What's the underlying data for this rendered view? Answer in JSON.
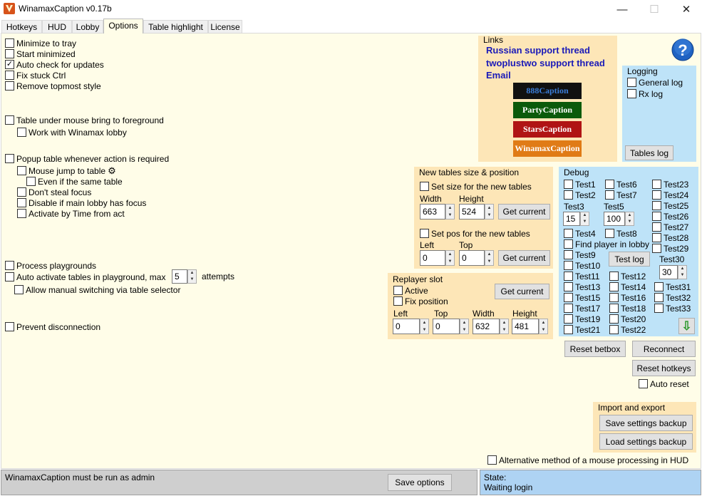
{
  "window": {
    "title": "WinamaxCaption v0.17b",
    "minimize": "—",
    "maximize": "☐",
    "close": "✕"
  },
  "tabs": [
    "Hotkeys",
    "HUD",
    "Lobby",
    "Options",
    "Table highlight",
    "License"
  ],
  "options": {
    "minimize_to_tray": "Minimize to tray",
    "start_minimized": "Start minimized",
    "auto_check_updates": "Auto check for updates",
    "fix_stuck_ctrl": "Fix stuck Ctrl",
    "remove_topmost": "Remove topmost style",
    "table_under_mouse": "Table under mouse bring to foreground",
    "work_with_lobby": "Work with Winamax lobby",
    "popup_table": "Popup table whenever action is required",
    "mouse_jump": "Mouse jump to table",
    "even_if_same": "Even if the same table",
    "dont_steal_focus": "Don't steal focus",
    "disable_if_lobby": "Disable if main lobby has focus",
    "activate_by_time": "Activate by Time from act",
    "process_playgrounds": "Process playgrounds",
    "auto_activate": "Auto activate tables in playground, max",
    "auto_activate_value": "5",
    "attempts": "attempts",
    "allow_manual": "Allow manual switching via table selector",
    "prevent_disconnection": "Prevent disconnection",
    "alt_mouse": "Alternative method of a mouse processing in HUD"
  },
  "links": {
    "title": "Links",
    "russian": "Russian support thread",
    "twoplustwo": "twoplustwo support thread",
    "email": "Email",
    "brands": [
      {
        "label": "888Caption",
        "bg": "#111111",
        "fg": "#3b7dd8"
      },
      {
        "label": "PartyCaption",
        "bg": "#0b5a0b",
        "fg": "#ffffff"
      },
      {
        "label": "StarsCaption",
        "bg": "#b01414",
        "fg": "#ffffff"
      },
      {
        "label": "WinamaxCaption",
        "bg": "#e07b16",
        "fg": "#ffffff"
      }
    ]
  },
  "logging": {
    "title": "Logging",
    "general": "General log",
    "rx": "Rx log",
    "tables_log": "Tables log"
  },
  "new_tables": {
    "title": "New tables size & position",
    "set_size": "Set size for the new tables",
    "width_label": "Width",
    "height_label": "Height",
    "width": "663",
    "height": "524",
    "get_current": "Get current",
    "set_pos": "Set pos for the new tables",
    "left_label": "Left",
    "top_label": "Top",
    "left": "0",
    "top": "0"
  },
  "replayer": {
    "title": "Replayer slot",
    "active": "Active",
    "fix_position": "Fix position",
    "get_current": "Get current",
    "left_label": "Left",
    "top_label": "Top",
    "width_label": "Width",
    "height_label": "Height",
    "left": "0",
    "top": "0",
    "width": "632",
    "height": "481"
  },
  "debug": {
    "title": "Debug",
    "test1": "Test1",
    "test2": "Test2",
    "test3": "Test3",
    "test3_value": "15",
    "test4": "Test4",
    "test5": "Test5",
    "test5_value": "100",
    "test6": "Test6",
    "test7": "Test7",
    "test8": "Test8",
    "find_player": "Find player in lobby",
    "test9": "Test9",
    "test_log": "Test log",
    "test10": "Test10",
    "test11": "Test11",
    "test12": "Test12",
    "test13": "Test13",
    "test14": "Test14",
    "test15": "Test15",
    "test16": "Test16",
    "test17": "Test17",
    "test18": "Test18",
    "test19": "Test19",
    "test20": "Test20",
    "test21": "Test21",
    "test22": "Test22",
    "test23": "Test23",
    "test24": "Test24",
    "test25": "Test25",
    "test26": "Test26",
    "test27": "Test27",
    "test28": "Test28",
    "test29": "Test29",
    "test30": "Test30",
    "test30_value": "30",
    "test31": "Test31",
    "test32": "Test32",
    "test33": "Test33",
    "down_arrow": "⇩"
  },
  "actions": {
    "reset_betbox": "Reset betbox",
    "reconnect": "Reconnect",
    "reset_hotkeys": "Reset hotkeys",
    "auto_reset": "Auto reset"
  },
  "import_export": {
    "title": "Import and export",
    "save": "Save settings backup",
    "load": "Load settings backup"
  },
  "status": {
    "admin_message": "WinamaxCaption must be run as admin",
    "save_options": "Save options",
    "state_label": "State:",
    "state_value": "Waiting login"
  }
}
